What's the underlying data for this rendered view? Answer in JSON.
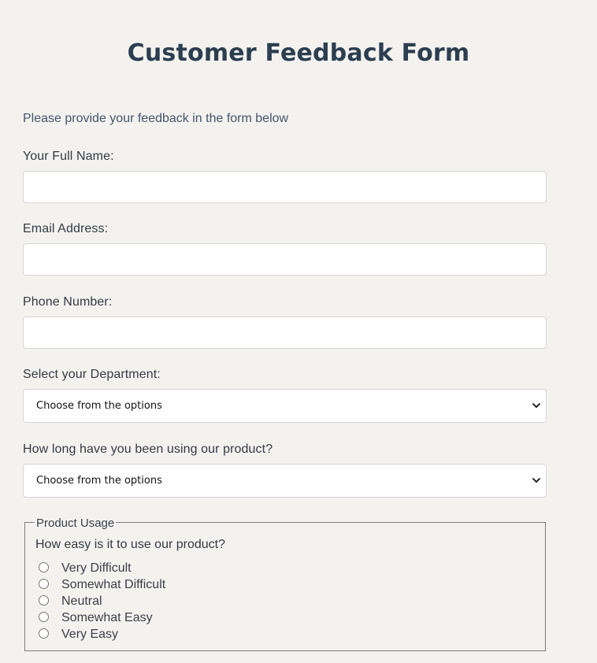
{
  "form": {
    "title": "Customer Feedback Form",
    "intro": "Please provide your feedback in the form below",
    "name_label": "Your Full Name:",
    "name_value": "",
    "email_label": "Email Address:",
    "email_value": "",
    "phone_label": "Phone Number:",
    "phone_value": "",
    "department_label": "Select your Department:",
    "department_selected": "Choose from the options",
    "usage_duration_label": "How long have you been using our product?",
    "usage_duration_selected": "Choose from the options",
    "product_usage": {
      "legend": "Product Usage",
      "question": "How easy is it to use our product?",
      "options": [
        "Very Difficult",
        "Somewhat Difficult",
        "Neutral",
        "Somewhat Easy",
        "Very Easy"
      ]
    }
  },
  "icons": {
    "select_arrow": "chevron-down-icon",
    "radio": "radio-unchecked"
  },
  "colors": {
    "background": "#f3f2ef",
    "title": "#2c3e50",
    "text": "#3a3f47",
    "input_bg": "#ffffff",
    "input_border": "#d6d6d6"
  }
}
